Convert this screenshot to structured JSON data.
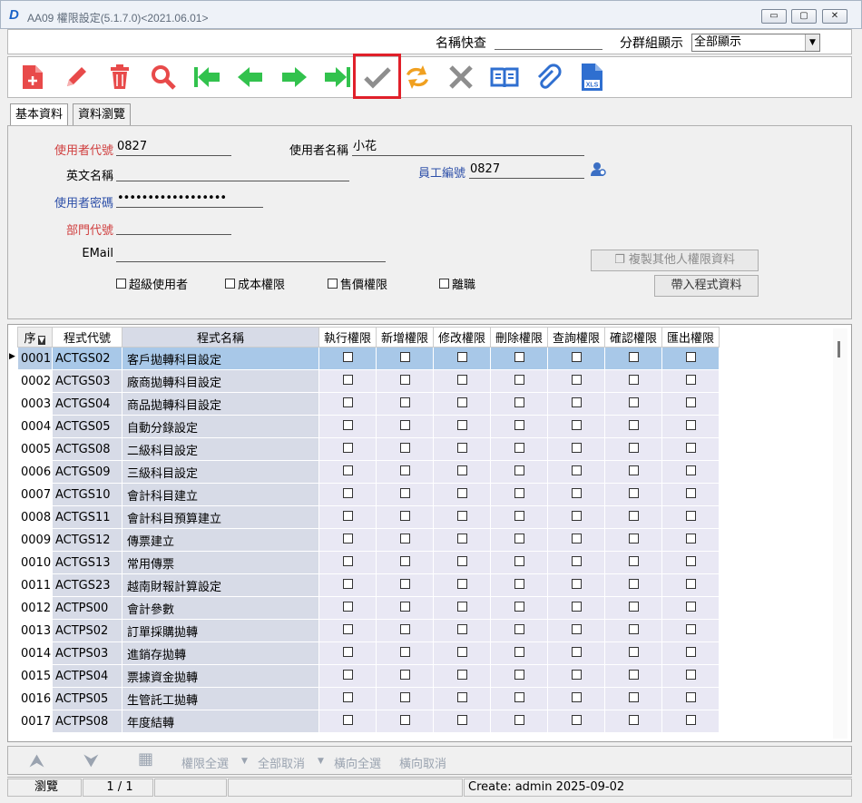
{
  "window": {
    "title": "AA09 權限設定(5.1.7.0)<2021.06.01>",
    "min": "▭",
    "max": "▢",
    "close": "✕"
  },
  "quickbar": {
    "search_label": "名稱快查",
    "search_value": "",
    "group_label": "分群組顯示",
    "group_selected": "全部顯示"
  },
  "toolbar": [
    {
      "icon": "add-document-icon",
      "color": "#e84a4a"
    },
    {
      "icon": "edit-pencil-icon",
      "color": "#e84a4a"
    },
    {
      "icon": "trash-icon",
      "color": "#e84a4a"
    },
    {
      "icon": "search-icon",
      "color": "#e84a4a"
    },
    {
      "icon": "first-record-icon",
      "color": "#32c24d"
    },
    {
      "icon": "prev-record-icon",
      "color": "#32c24d"
    },
    {
      "icon": "next-record-icon",
      "color": "#32c24d"
    },
    {
      "icon": "last-record-icon",
      "color": "#32c24d"
    },
    {
      "icon": "confirm-check-icon",
      "color": "#8e8e8e"
    },
    {
      "icon": "refresh-icon",
      "color": "#f0a020"
    },
    {
      "icon": "cancel-x-icon",
      "color": "#8e8e8e"
    },
    {
      "icon": "book-icon",
      "color": "#2f6fd0"
    },
    {
      "icon": "paperclip-icon",
      "color": "#2f6fd0"
    },
    {
      "icon": "xls-export-icon",
      "color": "#2f6fd0"
    }
  ],
  "tabs": {
    "basic": "基本資料",
    "browse": "資料瀏覽"
  },
  "form": {
    "user_id_label": "使用者代號",
    "user_id": "0827",
    "user_name_label": "使用者名稱",
    "user_name": "小花",
    "eng_name_label": "英文名稱",
    "eng_name": "",
    "emp_no_label": "員工編號",
    "emp_no": "0827",
    "password_label": "使用者密碼",
    "password": "••••••••••••••••••",
    "dept_label": "部門代號",
    "dept": "",
    "email_label": "EMail",
    "email": "",
    "chk_super": "超級使用者",
    "chk_cost": "成本權限",
    "chk_price": "售價權限",
    "chk_resigned": "離職",
    "copy_btn": "複製其他人權限資料",
    "import_btn": "帶入程式資料"
  },
  "grid": {
    "headers": {
      "code": "程式代號",
      "name": "程式名稱",
      "exec": "執行權限",
      "add": "新增權限",
      "modify": "修改權限",
      "delete": "刪除權限",
      "query": "查詢權限",
      "confirm": "確認權限",
      "export": "匯出權限"
    },
    "seq_header": "序",
    "rows": [
      {
        "seq": "0001",
        "code": "ACTGS02",
        "name": "客戶拋轉科目設定"
      },
      {
        "seq": "0002",
        "code": "ACTGS03",
        "name": "廠商拋轉科目設定"
      },
      {
        "seq": "0003",
        "code": "ACTGS04",
        "name": "商品拋轉科目設定"
      },
      {
        "seq": "0004",
        "code": "ACTGS05",
        "name": "自動分錄設定"
      },
      {
        "seq": "0005",
        "code": "ACTGS08",
        "name": "二級科目設定"
      },
      {
        "seq": "0006",
        "code": "ACTGS09",
        "name": "三級科目設定"
      },
      {
        "seq": "0007",
        "code": "ACTGS10",
        "name": "會計科目建立"
      },
      {
        "seq": "0008",
        "code": "ACTGS11",
        "name": "會計科目預算建立"
      },
      {
        "seq": "0009",
        "code": "ACTGS12",
        "name": "傳票建立"
      },
      {
        "seq": "0010",
        "code": "ACTGS13",
        "name": "常用傳票"
      },
      {
        "seq": "0011",
        "code": "ACTGS23",
        "name": "越南財報計算設定"
      },
      {
        "seq": "0012",
        "code": "ACTPS00",
        "name": "會計參數"
      },
      {
        "seq": "0013",
        "code": "ACTPS02",
        "name": "訂單採購拋轉"
      },
      {
        "seq": "0014",
        "code": "ACTPS03",
        "name": "進銷存拋轉"
      },
      {
        "seq": "0015",
        "code": "ACTPS04",
        "name": "票據資金拋轉"
      },
      {
        "seq": "0016",
        "code": "ACTPS05",
        "name": "生管託工拋轉"
      },
      {
        "seq": "0017",
        "code": "ACTPS08",
        "name": "年度結轉"
      }
    ]
  },
  "bottombar": {
    "all_perm": "權限全選",
    "all_cancel": "全部取消",
    "row_all": "橫向全選",
    "row_cancel": "橫向取消"
  },
  "status": {
    "mode": "瀏覽",
    "page": "1 / 1",
    "create": "Create: admin 2025-09-02"
  }
}
